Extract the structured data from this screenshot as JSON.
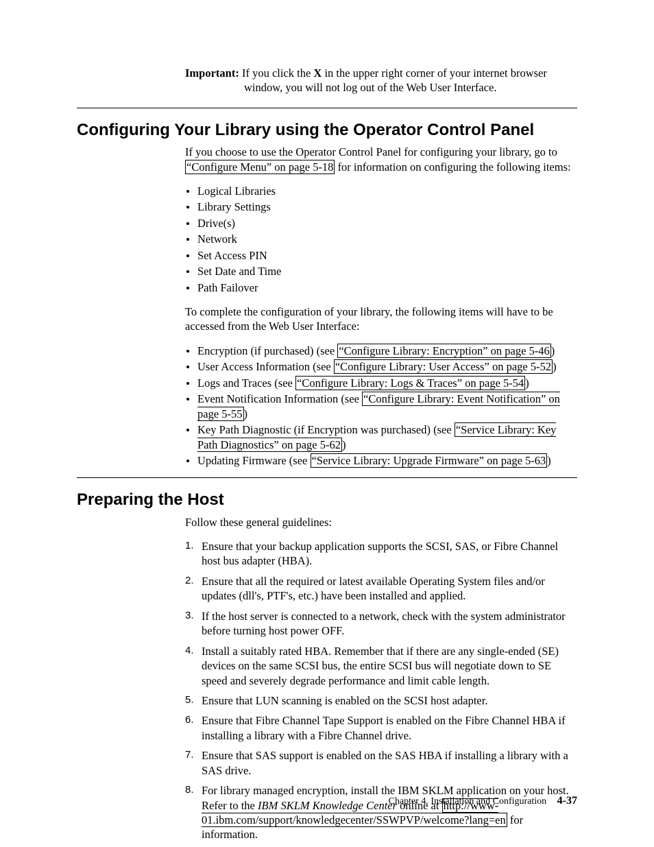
{
  "important": {
    "label": "Important:",
    "line1_a": "If you click the ",
    "line1_x": "X",
    "line1_b": " in the upper right corner of your internet browser",
    "line2": "window, you will not log out of the Web User Interface."
  },
  "sectionA": {
    "title": "Configuring Your Library using the Operator Control Panel",
    "intro_a": "If you choose to use the Operator Control Panel for configuring your library, go to ",
    "intro_link": "“Configure Menu” on page 5-18",
    "intro_b": " for information on configuring the following items:",
    "items": [
      "Logical Libraries",
      "Library Settings",
      "Drive(s)",
      "Network",
      "Set Access PIN",
      "Set Date and Time",
      "Path Failover"
    ],
    "intro2": "To complete the configuration of your library, the following items will have to be accessed from the Web User Interface:",
    "xitems": [
      {
        "pre": "Encryption (if purchased) (see ",
        "link": "“Configure Library: Encryption” on page 5-46",
        "post": ")"
      },
      {
        "pre": "User Access Information (see ",
        "link": "“Configure Library: User Access” on page 5-52",
        "post": ")"
      },
      {
        "pre": "Logs and Traces (see ",
        "link": "“Configure Library: Logs & Traces” on page 5-54",
        "post": ")"
      },
      {
        "pre": "Event Notification Information (see ",
        "link": "“Configure Library: Event Notification” on page 5-55",
        "post": ")"
      },
      {
        "pre": "Key Path Diagnostic (if Encryption was purchased) (see ",
        "link": "“Service Library: Key Path Diagnostics” on page 5-62",
        "post": ")"
      },
      {
        "pre": "Updating Firmware (see ",
        "link": "“Service Library: Upgrade Firmware” on page 5-63",
        "post": ")"
      }
    ]
  },
  "sectionB": {
    "title": "Preparing the Host",
    "intro": "Follow these general guidelines:",
    "steps": {
      "s1": "Ensure that your backup application supports the SCSI, SAS, or Fibre Channel host bus adapter (HBA).",
      "s2": "Ensure that all the required or latest available Operating System files and/or updates (dll's, PTF's, etc.) have been installed and applied.",
      "s3": "If the host server is connected to a network, check with the system administrator before turning host power OFF.",
      "s4": "Install a suitably rated HBA. Remember that if there are any single-ended (SE) devices on the same SCSI bus, the entire SCSI bus will negotiate down to SE speed and severely degrade performance and limit cable length.",
      "s5": "Ensure that LUN scanning is enabled on the SCSI host adapter.",
      "s6": "Ensure that Fibre Channel Tape Support is enabled on the Fibre Channel HBA if installing a library with a Fibre Channel drive.",
      "s7": "Ensure that SAS support is enabled on the SAS HBA if installing a library with a SAS drive.",
      "s8a": "For library managed encryption, install the IBM SKLM application on your host. Refer to the ",
      "s8em": "IBM SKLM Knowledge Center",
      "s8b": " online at ",
      "s8link": "http://www-01.ibm.com/support/knowledgecenter/SSWPVP/welcome?lang=en",
      "s8c": " for information."
    }
  },
  "footer": {
    "chapter": "Chapter 4. Installation and Configuration",
    "page": "4-37"
  }
}
